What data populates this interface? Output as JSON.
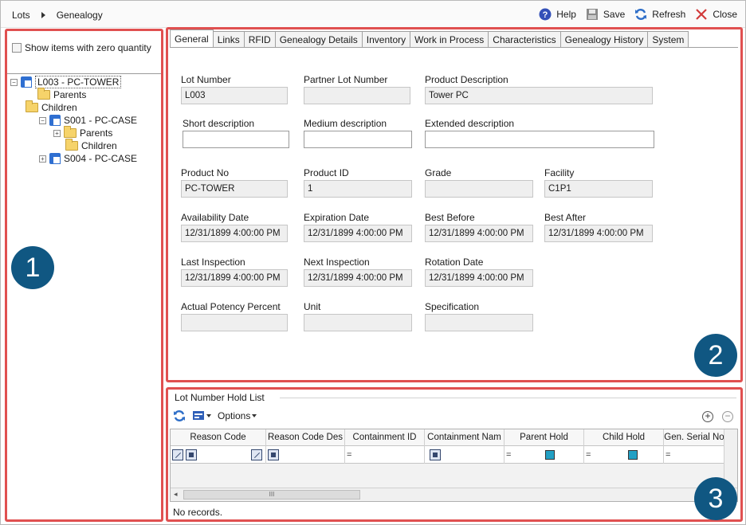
{
  "breadcrumb": [
    "Lots",
    "Genealogy"
  ],
  "toolbar": {
    "help": "Help",
    "save": "Save",
    "refresh": "Refresh",
    "close": "Close"
  },
  "left": {
    "show_zero_label": "Show items with zero quantity",
    "tree": [
      {
        "label": "L003 - PC-TOWER",
        "kind": "lot",
        "expander": "−"
      },
      {
        "label": "Parents",
        "kind": "folder"
      },
      {
        "label": "Children",
        "kind": "folder"
      },
      {
        "label": "S001 - PC-CASE",
        "kind": "lot",
        "expander": "−"
      },
      {
        "label": "Parents",
        "kind": "folder",
        "expander": "+"
      },
      {
        "label": "Children",
        "kind": "folder"
      },
      {
        "label": "S004 - PC-CASE",
        "kind": "lot",
        "expander": "+"
      }
    ]
  },
  "tabs": [
    "General",
    "Links",
    "RFID",
    "Genealogy Details",
    "Inventory",
    "Work in Process",
    "Characteristics",
    "Genealogy History",
    "System"
  ],
  "active_tab": "General",
  "fields": {
    "lot_number": {
      "label": "Lot Number",
      "value": "L003"
    },
    "partner_lot_number": {
      "label": "Partner Lot Number",
      "value": ""
    },
    "product_description": {
      "label": "Product Description",
      "value": "Tower PC"
    },
    "short_description": {
      "label": "Short description",
      "value": ""
    },
    "medium_description": {
      "label": "Medium description",
      "value": ""
    },
    "extended_description": {
      "label": "Extended description",
      "value": ""
    },
    "product_no": {
      "label": "Product No",
      "value": "PC-TOWER"
    },
    "product_id": {
      "label": "Product ID",
      "value": "1"
    },
    "grade": {
      "label": "Grade",
      "value": ""
    },
    "facility": {
      "label": "Facility",
      "value": "C1P1"
    },
    "availability_date": {
      "label": "Availability Date",
      "value": "12/31/1899 4:00:00 PM"
    },
    "expiration_date": {
      "label": "Expiration Date",
      "value": "12/31/1899 4:00:00 PM"
    },
    "best_before": {
      "label": "Best Before",
      "value": "12/31/1899 4:00:00 PM"
    },
    "best_after": {
      "label": "Best After",
      "value": "12/31/1899 4:00:00 PM"
    },
    "last_inspection": {
      "label": "Last Inspection",
      "value": "12/31/1899 4:00:00 PM"
    },
    "next_inspection": {
      "label": "Next Inspection",
      "value": "12/31/1899 4:00:00 PM"
    },
    "rotation_date": {
      "label": "Rotation Date",
      "value": "12/31/1899 4:00:00 PM"
    },
    "actual_potency_percent": {
      "label": "Actual Potency Percent",
      "value": ""
    },
    "unit": {
      "label": "Unit",
      "value": ""
    },
    "specification": {
      "label": "Specification",
      "value": ""
    }
  },
  "hold_list": {
    "title": "Lot Number Hold List",
    "options_label": "Options",
    "columns": [
      "Reason Code",
      "Reason Code Des",
      "Containment ID",
      "Containment Nam",
      "Parent Hold",
      "Child Hold",
      "Gen. Serial No"
    ],
    "empty_text": "No records.",
    "scroll_grip": "III"
  },
  "badges": [
    "1",
    "2",
    "3"
  ],
  "colors": {
    "callout_border": "#e05050",
    "badge_fill": "#105782",
    "help_icon": "#3350b8",
    "close_icon": "#d23a3a"
  }
}
